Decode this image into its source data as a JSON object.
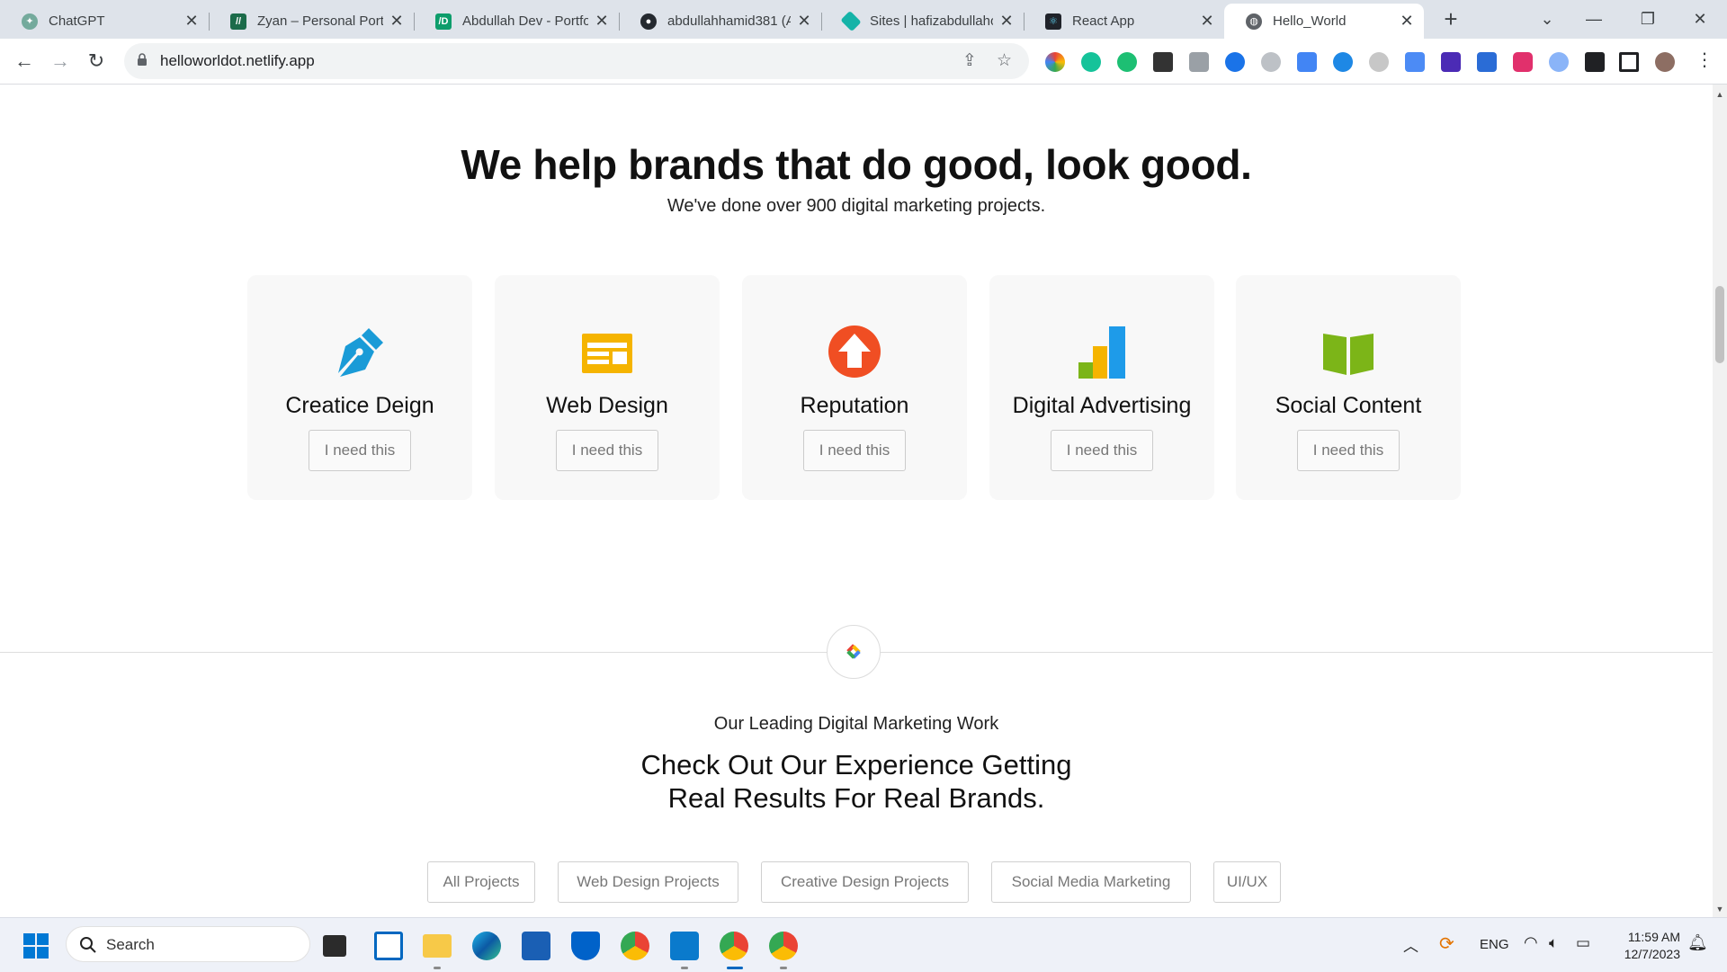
{
  "browser": {
    "tabs": [
      {
        "title": "ChatGPT",
        "favicon": "chatgpt-icon",
        "active": false
      },
      {
        "title": "Zyan – Personal Portf",
        "favicon": "zyan-icon",
        "active": false
      },
      {
        "title": "Abdullah Dev - Portfo",
        "favicon": "dev-icon",
        "active": false
      },
      {
        "title": "abdullahhamid381 (A",
        "favicon": "github-icon",
        "active": false
      },
      {
        "title": "Sites | hafizabdullaho",
        "favicon": "netlify-icon",
        "active": false
      },
      {
        "title": "React App",
        "favicon": "react-icon",
        "active": false
      },
      {
        "title": "Hello_World",
        "favicon": "globe-icon",
        "active": true
      }
    ],
    "url": "helloworldot.netlify.app"
  },
  "hero": {
    "title": "We help brands that do good, look good.",
    "subtitle": "We've done over 900 digital marketing projects."
  },
  "services": [
    {
      "title": "Creatice Deign",
      "button": "I need this",
      "icon": "pen-nib-icon",
      "color": "#1a9bd7"
    },
    {
      "title": "Web Design",
      "button": "I need this",
      "icon": "layout-icon",
      "color": "#f5b400"
    },
    {
      "title": "Reputation",
      "button": "I need this",
      "icon": "arrow-up-circle-icon",
      "color": "#f04e23"
    },
    {
      "title": "Digital Advertising",
      "button": "I need this",
      "icon": "bar-chart-icon",
      "color": "#1e9be9"
    },
    {
      "title": "Social Content",
      "button": "I need this",
      "icon": "open-book-icon",
      "color": "#7cb518"
    }
  ],
  "work": {
    "kicker": "Our Leading Digital Marketing Work",
    "title_line1": "Check Out Our Experience Getting",
    "title_line2": "Real Results For Real Brands.",
    "filters": [
      "All Projects",
      "Web Design Projects",
      "Creative Design Projects",
      "Social Media Marketing",
      "UI/UX"
    ]
  },
  "taskbar": {
    "search_placeholder": "Search",
    "language": "ENG",
    "time": "11:59 AM",
    "date": "12/7/2023"
  }
}
